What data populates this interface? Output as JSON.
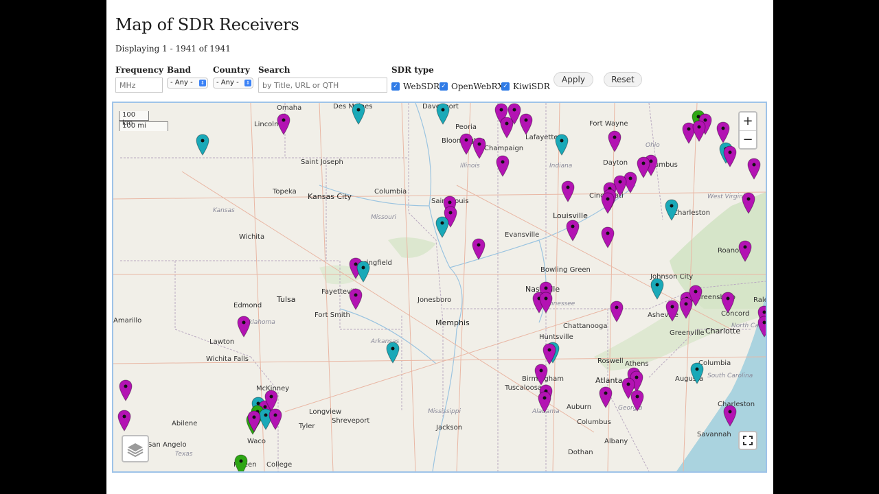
{
  "page": {
    "title": "Map of SDR Receivers",
    "displaying": "Displaying 1 - 1941 of 1941"
  },
  "filters": {
    "frequency_label": "Frequency",
    "frequency_placeholder": "MHz",
    "band_label": "Band",
    "band_value": "- Any -",
    "country_label": "Country",
    "country_value": "- Any -",
    "search_label": "Search",
    "search_placeholder": "by Title, URL or QTH",
    "sdr_type_label": "SDR type",
    "types": [
      {
        "label": "WebSDR",
        "checked": true
      },
      {
        "label": "OpenWebRX",
        "checked": true
      },
      {
        "label": "KiwiSDR",
        "checked": true
      }
    ],
    "apply_label": "Apply",
    "reset_label": "Reset"
  },
  "map": {
    "zoom_in": "+",
    "zoom_out": "−",
    "scale_km": "100 km",
    "scale_mi": "100 mi",
    "cities": [
      "Omaha",
      "Des Moines",
      "Davenport",
      "Lincoln",
      "Peoria",
      "Fort Wayne",
      "Bloomington",
      "Champaign",
      "Lafayette",
      "Dayton",
      "Columbus",
      "Saint Joseph",
      "Kansas City",
      "Columbia",
      "Topeka",
      "Saint Louis",
      "Cincinnati",
      "Charleston",
      "Louisville",
      "Wichita",
      "Evansville",
      "Roanoke",
      "Springfield",
      "Bowling Green",
      "Johnson City",
      "Fayetteville",
      "Tulsa",
      "Jonesboro",
      "Nashville",
      "Greensboro",
      "Raleigh",
      "Edmond",
      "Fort Smith",
      "Asheville",
      "Concord",
      "Memphis",
      "Chattanooga",
      "Amarillo",
      "Lawton",
      "Greenville",
      "Charlotte",
      "Huntsville",
      "Wichita Falls",
      "Roswell",
      "Athens",
      "Columbia",
      "Birmingham",
      "Atlanta",
      "Augusta",
      "McKinney",
      "Longview",
      "Tuscaloosa",
      "Abilene",
      "Shreveport",
      "Tyler",
      "Auburn",
      "Charleston",
      "Columbus",
      "Savannah",
      "Waco",
      "Jackson",
      "San Angelo",
      "Albany",
      "Dothan",
      "College",
      "Killeen"
    ],
    "states": [
      "Kansas",
      "Missouri",
      "Illinois",
      "Indiana",
      "Ohio",
      "West Virginia",
      "Tennessee",
      "Oklahoma",
      "Arkansas",
      "Mississippi",
      "Alabama",
      "Georgia",
      "South Carolina",
      "Texas",
      "North Carolina"
    ],
    "pin_colors": {
      "websdr": "#b313b3",
      "openwebrx": "#1aa9b8",
      "kiwisdr": "#2ea614"
    }
  }
}
